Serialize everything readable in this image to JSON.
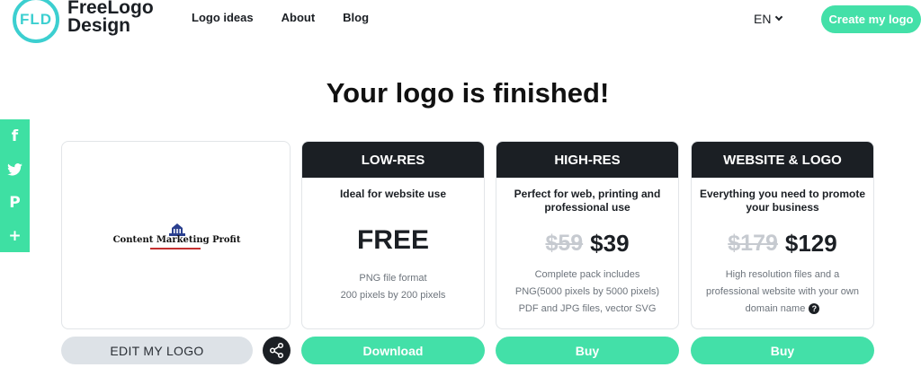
{
  "header": {
    "logo_mark": "FLD",
    "logo_line1": "FreeLogo",
    "logo_line2": "Design",
    "nav": [
      "Logo ideas",
      "About",
      "Blog"
    ],
    "language": "EN",
    "cta": "Create my logo"
  },
  "title": "Your logo is finished!",
  "social": {
    "items": [
      "f",
      "t",
      "P",
      "+"
    ],
    "icons": [
      "facebook-icon",
      "twitter-icon",
      "pinterest-icon",
      "plus-icon"
    ],
    "color": "#3ee0a3"
  },
  "preview": {
    "logo_name": "Content Marketing Profit",
    "edit_label": "EDIT MY LOGO"
  },
  "plans": [
    {
      "name": "LOW-RES",
      "subtitle": "Ideal for website use",
      "price": "FREE",
      "details": [
        "PNG file format",
        "200 pixels by 200 pixels"
      ],
      "action": "Download"
    },
    {
      "name": "HIGH-RES",
      "subtitle": "Perfect for web, printing and professional use",
      "old_price": "$59",
      "price": "$39",
      "details": [
        "Complete pack includes",
        "PNG(5000 pixels by 5000 pixels)",
        "PDF and JPG files, vector SVG"
      ],
      "action": "Buy"
    },
    {
      "name": "WEBSITE & LOGO",
      "subtitle": "Everything you need to promote your business",
      "old_price": "$179",
      "price": "$129",
      "details": [
        "High resolution files and a",
        "professional website with your own",
        "domain name"
      ],
      "help_icon": "?",
      "action": "Buy"
    }
  ],
  "colors": {
    "accent": "#43e0a8",
    "dark": "#1b1f24",
    "brand_ring": "#3ccfd0"
  }
}
